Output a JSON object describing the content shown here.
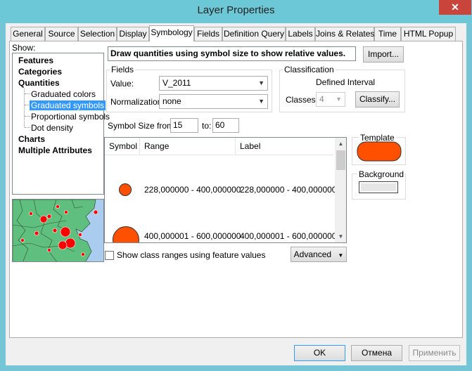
{
  "window": {
    "title": "Layer Properties",
    "close_label": "✕"
  },
  "tabs": [
    {
      "label": "General"
    },
    {
      "label": "Source"
    },
    {
      "label": "Selection"
    },
    {
      "label": "Display"
    },
    {
      "label": "Symbology"
    },
    {
      "label": "Fields"
    },
    {
      "label": "Definition Query"
    },
    {
      "label": "Labels"
    },
    {
      "label": "Joins & Relates"
    },
    {
      "label": "Time"
    },
    {
      "label": "HTML Popup"
    }
  ],
  "show": {
    "label": "Show:",
    "items": [
      {
        "label": "Features"
      },
      {
        "label": "Categories"
      },
      {
        "label": "Quantities"
      },
      {
        "label": "Graduated colors"
      },
      {
        "label": "Graduated symbols"
      },
      {
        "label": "Proportional symbols"
      },
      {
        "label": "Dot density"
      },
      {
        "label": "Charts"
      },
      {
        "label": "Multiple Attributes"
      }
    ]
  },
  "description": "Draw quantities using symbol size to show relative values.",
  "import_label": "Import...",
  "fields": {
    "title": "Fields",
    "value_label": "Value:",
    "value": "V_2011",
    "normalization_label": "Normalization:",
    "normalization": "none"
  },
  "classification": {
    "title": "Classification",
    "method": "Defined Interval",
    "classes_label": "Classes:",
    "classes": "4",
    "classify_label": "Classify..."
  },
  "symbol_size": {
    "from_label": "Symbol Size from:",
    "from": "15",
    "to_label": "to:",
    "to": "60"
  },
  "table": {
    "headers": {
      "symbol": "Symbol",
      "range": "Range",
      "label": "Label"
    },
    "rows": [
      {
        "range": "228,000000 - 400,000000",
        "label": "228,000000 - 400,000000"
      },
      {
        "range": "400,000001 - 600,000000",
        "label": "400,000001 - 600,000000"
      }
    ]
  },
  "template": {
    "label": "Template",
    "color": "#ff5000"
  },
  "background": {
    "label": "Background"
  },
  "show_ranges_label": "Show class ranges using feature values",
  "advanced_label": "Advanced",
  "footer": {
    "ok": "OK",
    "cancel": "Отмена",
    "apply": "Применить"
  },
  "colors": {
    "accent": "#3399ff",
    "symbol": "#ff5000",
    "map_land": "#5fbf7f",
    "map_water": "#a9ccef",
    "map_point": "#ff0000"
  }
}
